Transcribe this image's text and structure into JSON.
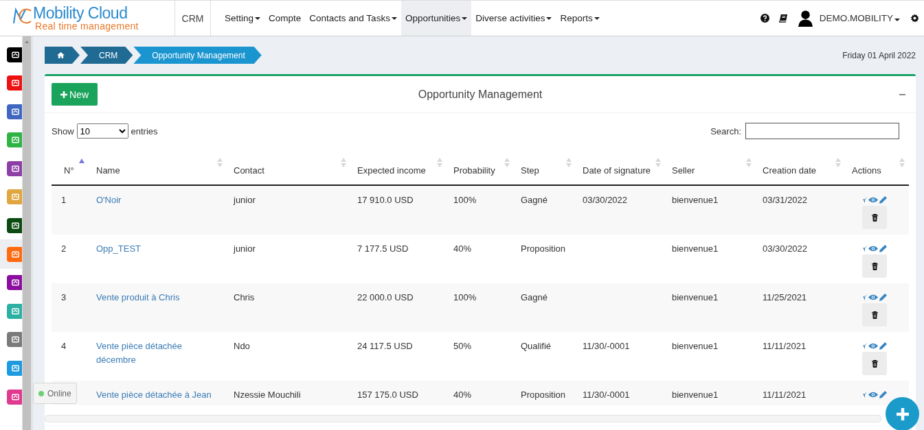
{
  "brand": {
    "name": "Mobility Cloud",
    "tagline": "Real time management"
  },
  "module": "CRM",
  "nav": [
    {
      "label": "Setting",
      "dropdown": true,
      "selected": false
    },
    {
      "label": "Compte",
      "dropdown": false,
      "selected": false
    },
    {
      "label": "Contacts and Tasks",
      "dropdown": true,
      "selected": false
    },
    {
      "label": "Opportunities",
      "dropdown": true,
      "selected": true
    },
    {
      "label": "Diverse activities",
      "dropdown": true,
      "selected": false
    },
    {
      "label": "Reports",
      "dropdown": true,
      "selected": false
    }
  ],
  "user": {
    "name": "DEMO.MOBILITY"
  },
  "sidebar": [
    {
      "color": "#000000",
      "selected": false
    },
    {
      "color": "#ee1111",
      "selected": false
    },
    {
      "color": "#3f67c1",
      "selected": false
    },
    {
      "color": "#2fb344",
      "selected": false
    },
    {
      "color": "#8e3fa6",
      "selected": false
    },
    {
      "color": "#e0a640",
      "selected": false
    },
    {
      "color": "#0b4a10",
      "selected": false
    },
    {
      "color": "#ff6a10",
      "selected": true
    },
    {
      "color": "#8a0f9e",
      "selected": false
    },
    {
      "color": "#2bb0a3",
      "selected": false
    },
    {
      "color": "#7a7a7a",
      "selected": false
    },
    {
      "color": "#1e9be0",
      "selected": false
    },
    {
      "color": "#e0398f",
      "selected": false
    }
  ],
  "breadcrumb": [
    "CRM",
    "Opportunity Management"
  ],
  "date": "Friday 01 April 2022",
  "card": {
    "title": "Opportunity Management",
    "new_button": "New"
  },
  "length": {
    "show": "Show",
    "value": "10",
    "entries": "entries"
  },
  "search": {
    "label": "Search:"
  },
  "columns": [
    {
      "label": "N°",
      "sorted": true
    },
    {
      "label": "Name",
      "sorted": false
    },
    {
      "label": "Contact",
      "sorted": false
    },
    {
      "label": "Expected income",
      "sorted": false
    },
    {
      "label": "Probability",
      "sorted": false
    },
    {
      "label": "Step",
      "sorted": false
    },
    {
      "label": "Date of signature",
      "sorted": false
    },
    {
      "label": "Seller",
      "sorted": false
    },
    {
      "label": "Creation date",
      "sorted": false
    },
    {
      "label": "Actions",
      "sorted": false
    }
  ],
  "rows": [
    {
      "no": "1",
      "name": "O'Noir",
      "contact": "junior",
      "income": "17 910.0 USD",
      "probability": "100%",
      "step": "Gagné",
      "signature": "03/30/2022",
      "seller": "bienvenue1",
      "created": "03/31/2022",
      "delete": true
    },
    {
      "no": "2",
      "name": "Opp_TEST",
      "contact": "junior",
      "income": "7 177.5 USD",
      "probability": "40%",
      "step": "Proposition",
      "signature": "",
      "seller": "bienvenue1",
      "created": "03/30/2022",
      "delete": true
    },
    {
      "no": "3",
      "name": "Vente produit à Chris",
      "contact": "Chris",
      "income": "22 000.0 USD",
      "probability": "100%",
      "step": "Gagné",
      "signature": "",
      "seller": "bienvenue1",
      "created": "11/25/2021",
      "delete": true
    },
    {
      "no": "4",
      "name": "Vente pièce détachée décembre",
      "contact": "Ndo",
      "income": "24 117.5 USD",
      "probability": "50%",
      "step": "Qualifié",
      "signature": "11/30/-0001",
      "seller": "bienvenue1",
      "created": "11/11/2021",
      "delete": true
    },
    {
      "name": "Vente pièce détachée à Jean",
      "contact": "Nzessie Mouchili",
      "income": "157 175.0 USD",
      "probability": "40%",
      "step": "Proposition",
      "signature": "11/30/-0001",
      "seller": "bienvenue1",
      "created": "11/11/2021",
      "delete": false
    }
  ],
  "status": {
    "label": "Online",
    "online": true
  }
}
